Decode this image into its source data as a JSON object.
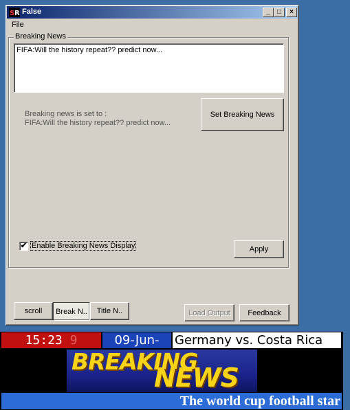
{
  "window": {
    "title": "False",
    "controls": {
      "minimize": "_",
      "maximize": "□",
      "close": "×"
    }
  },
  "menu": {
    "file": "File"
  },
  "group": {
    "label": "Breaking News",
    "text_value": "FIFA:Will the history repeat?? predict now...",
    "status_line1": "Breaking news is set to :",
    "status_line2": "FIFA:Will the history repeat?? predict now...",
    "set_button": "Set Breaking News",
    "enable_label": "Enable Breaking News Display",
    "enable_checked": "✔",
    "apply_button": "Apply"
  },
  "tabs": {
    "scroll": "scroll",
    "break": "Break N..",
    "title": "Title N.."
  },
  "footer": {
    "load_output": "Load Output",
    "feedback": "Feedback"
  },
  "ticker": {
    "time": "15:23",
    "seconds": "9",
    "date": "09-Jun-",
    "match": "Germany vs. Costa Rica",
    "logo_top": "BREAKING",
    "logo_bottom": "NEWS",
    "crawl": "The world cup football star"
  },
  "colors": {
    "titlebar_start": "#0a246a",
    "titlebar_end": "#a6caf0",
    "face": "#d4d0c8",
    "time_bg": "#c01010",
    "date_bg": "#1a44b8",
    "logo_text": "#f7d417",
    "crawl_bg": "#2b6cd6"
  }
}
